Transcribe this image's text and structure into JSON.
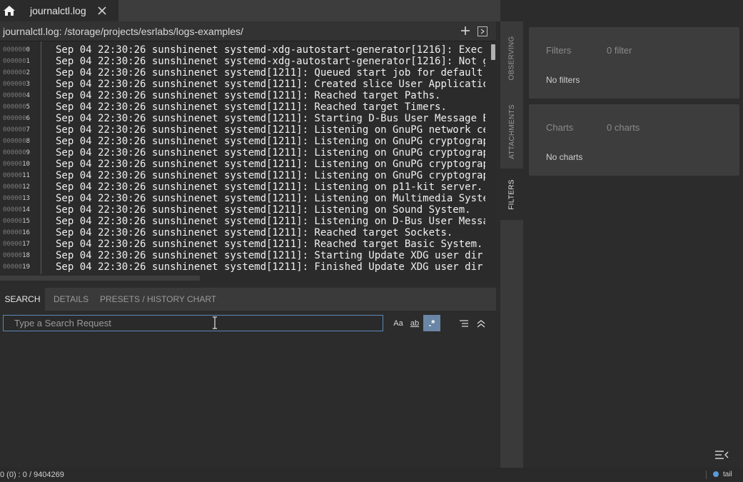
{
  "tab": {
    "title": "journalctl.log"
  },
  "path": {
    "text": "journalctl.log: /storage/projects/esrlabs/logs-examples/"
  },
  "log": {
    "rows": [
      {
        "pad": "000000",
        "idx": "0",
        "text": "Sep 04 22:30:26 sunshinenet systemd-xdg-autostart-generator[1216]: Exec bi"
      },
      {
        "pad": "000000",
        "idx": "1",
        "text": "Sep 04 22:30:26 sunshinenet systemd-xdg-autostart-generator[1216]: Not gen"
      },
      {
        "pad": "000000",
        "idx": "2",
        "text": "Sep 04 22:30:26 sunshinenet systemd[1211]: Queued start job for default ta"
      },
      {
        "pad": "000000",
        "idx": "3",
        "text": "Sep 04 22:30:26 sunshinenet systemd[1211]: Created slice User Application"
      },
      {
        "pad": "000000",
        "idx": "4",
        "text": "Sep 04 22:30:26 sunshinenet systemd[1211]: Reached target Paths."
      },
      {
        "pad": "000000",
        "idx": "5",
        "text": "Sep 04 22:30:26 sunshinenet systemd[1211]: Reached target Timers."
      },
      {
        "pad": "000000",
        "idx": "6",
        "text": "Sep 04 22:30:26 sunshinenet systemd[1211]: Starting D-Bus User Message Bus"
      },
      {
        "pad": "000000",
        "idx": "7",
        "text": "Sep 04 22:30:26 sunshinenet systemd[1211]: Listening on GnuPG network cert"
      },
      {
        "pad": "000000",
        "idx": "8",
        "text": "Sep 04 22:30:26 sunshinenet systemd[1211]: Listening on GnuPG cryptographi"
      },
      {
        "pad": "000000",
        "idx": "9",
        "text": "Sep 04 22:30:26 sunshinenet systemd[1211]: Listening on GnuPG cryptographi"
      },
      {
        "pad": "00000",
        "idx": "10",
        "text": "Sep 04 22:30:26 sunshinenet systemd[1211]: Listening on GnuPG cryptographi"
      },
      {
        "pad": "00000",
        "idx": "11",
        "text": "Sep 04 22:30:26 sunshinenet systemd[1211]: Listening on GnuPG cryptographi"
      },
      {
        "pad": "00000",
        "idx": "12",
        "text": "Sep 04 22:30:26 sunshinenet systemd[1211]: Listening on p11-kit server."
      },
      {
        "pad": "00000",
        "idx": "13",
        "text": "Sep 04 22:30:26 sunshinenet systemd[1211]: Listening on Multimedia System."
      },
      {
        "pad": "00000",
        "idx": "14",
        "text": "Sep 04 22:30:26 sunshinenet systemd[1211]: Listening on Sound System."
      },
      {
        "pad": "00000",
        "idx": "15",
        "text": "Sep 04 22:30:26 sunshinenet systemd[1211]: Listening on D-Bus User Message"
      },
      {
        "pad": "00000",
        "idx": "16",
        "text": "Sep 04 22:30:26 sunshinenet systemd[1211]: Reached target Sockets."
      },
      {
        "pad": "00000",
        "idx": "17",
        "text": "Sep 04 22:30:26 sunshinenet systemd[1211]: Reached target Basic System."
      },
      {
        "pad": "00000",
        "idx": "18",
        "text": "Sep 04 22:30:26 sunshinenet systemd[1211]: Starting Update XDG user dir co"
      },
      {
        "pad": "00000",
        "idx": "19",
        "text": "Sep 04 22:30:26 sunshinenet systemd[1211]: Finished Update XDG user dir co"
      }
    ]
  },
  "lower_tabs": [
    "SEARCH",
    "DETAILS",
    "PRESETS / HISTORY",
    "CHART"
  ],
  "search": {
    "placeholder": "Type a Search Request",
    "case_label": "Aa",
    "word_label": "ab",
    "regex_label": ".*"
  },
  "side_tabs": [
    "OBSERVING",
    "ATTACHMENTS",
    "FILTERS"
  ],
  "filters_card": {
    "title": "Filters",
    "count": "0 filter",
    "empty": "No filters"
  },
  "charts_card": {
    "title": "Charts",
    "count": "0 charts",
    "empty": "No charts"
  },
  "status": {
    "position": "0 (0) : 0 / 9404269",
    "tail": "tail"
  },
  "colors": {
    "accent": "#5b88b8",
    "regex_active": "#6a86a6",
    "tail_dot": "#5b9ad5"
  }
}
